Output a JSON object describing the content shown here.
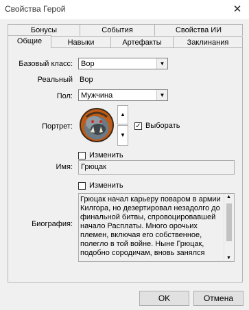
{
  "window": {
    "title": "Свойства Герой",
    "close_symbol": "✕"
  },
  "tabs": {
    "row1": [
      "Бонусы",
      "События",
      "Свойства ИИ"
    ],
    "row2": [
      "Общие",
      "Навыки",
      "Артефакты",
      "Заклинания"
    ],
    "active": "Общие"
  },
  "general": {
    "base_class_label": "Базовый класс:",
    "base_class_value": "Вор",
    "real_label": "Реальный",
    "real_value": "Вор",
    "gender_label": "Пол:",
    "gender_value": "Мужчина",
    "portrait_label": "Портрет:",
    "portrait_select_label": "Выборать",
    "portrait_select_checked": true,
    "name_change_label": "Изменить",
    "name_label": "Имя:",
    "name_value": "Грюцак",
    "bio_change_label": "Изменить",
    "bio_label": "Биография:",
    "biography": "Грюцак начал карьеру поваром в армии Килгора, но дезертировал незадолго до финальной битвы, спровоцировавшей начало Расплаты. Много орочьих племен, включая его собственное, полегло в той войне. Ныне Грюцак, подобно сородичам, вновь занялся"
  },
  "footer": {
    "ok_label": "OK",
    "cancel_label": "Отмена"
  },
  "icons": {
    "close": "close-icon",
    "dropdown": "chevron-down-icon",
    "spin_up": "arrow-up-icon",
    "spin_down": "arrow-down-icon",
    "check": "checkmark-icon"
  }
}
